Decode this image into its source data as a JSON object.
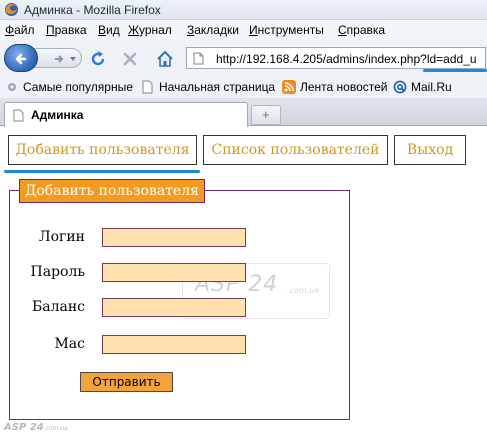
{
  "window": {
    "title": "Админка - Mozilla Firefox"
  },
  "menu": [
    "Файл",
    "Правка",
    "Вид",
    "Журнал",
    "Закладки",
    "Инструменты",
    "Справка"
  ],
  "menu_underline_letters": [
    "Ф",
    "П",
    "В",
    "Ж",
    "З",
    "И",
    "С"
  ],
  "url": "http://192.168.4.205/admins/index.php?ld=add_u",
  "bookmarks": {
    "popular": "Самые популярные",
    "home": "Начальная страница",
    "news": "Лента новостей",
    "mailru": "Mail.Ru"
  },
  "tab": {
    "title": "Админка",
    "new_tab_symbol": "+"
  },
  "page": {
    "nav": {
      "add_user": "Добавить пользователя",
      "user_list": "Список пользователей",
      "logout": "Выход"
    },
    "form": {
      "legend": "Добавить пользователя",
      "fields": [
        {
          "label": "Логин",
          "value": ""
        },
        {
          "label": "Пароль",
          "value": ""
        },
        {
          "label": "Баланс",
          "value": ""
        },
        {
          "label": "Мас",
          "value": ""
        }
      ],
      "submit_label": "Отправить"
    },
    "watermark": {
      "main": "ASP 24",
      "sub": ".com.ua"
    },
    "watermark_footer": {
      "main": "ASP 24",
      "sub": ".com.ua"
    }
  },
  "colors": {
    "accent_orange": "#f39a1f",
    "input_fill": "#ffe1b0",
    "fieldset_border": "#6f2b72",
    "nav_text": "#d29622",
    "highlight_underline": "#1e8ad6"
  },
  "icons": {
    "app": "firefox-icon",
    "back": "back-arrow-icon",
    "forward": "forward-arrow-icon",
    "reload": "reload-icon",
    "stop": "stop-icon",
    "home": "home-icon",
    "page": "page-icon",
    "rss": "rss-icon",
    "mailru": "mailru-at-icon"
  }
}
